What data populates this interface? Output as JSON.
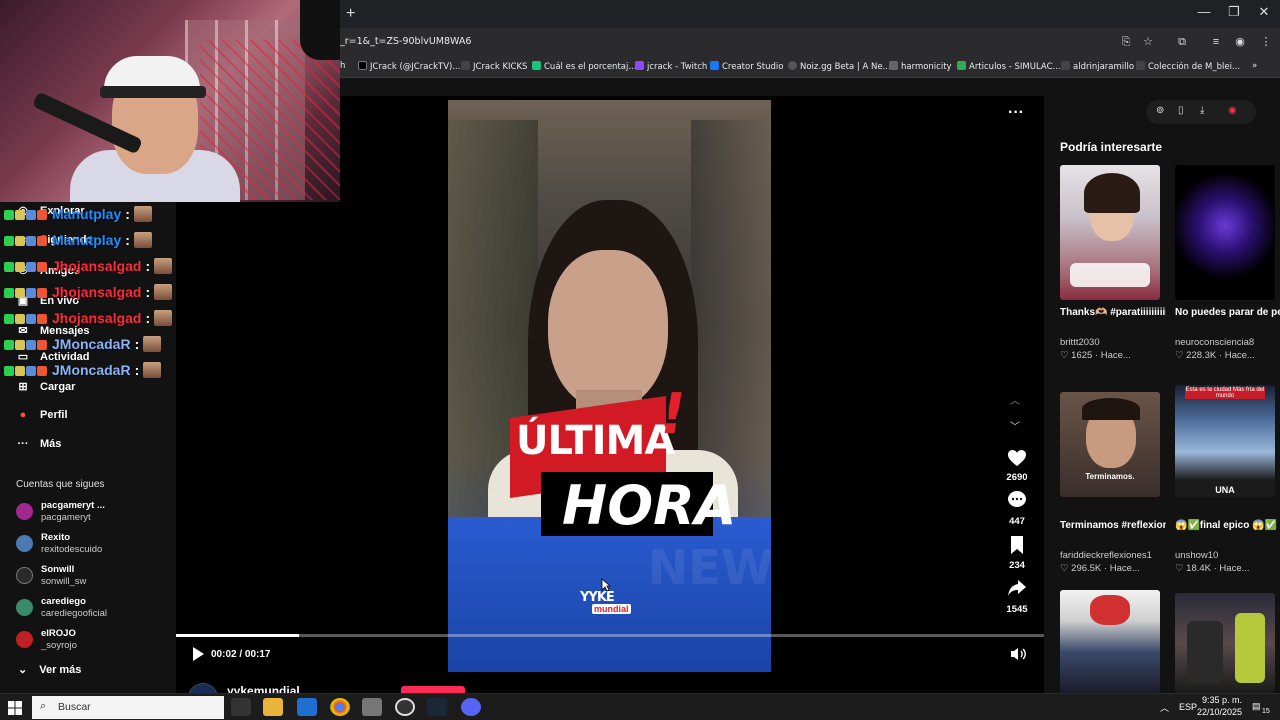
{
  "browser": {
    "url": "_r=1&_t=ZS-90blvUM8WA6",
    "new_tab": "+",
    "bookmarks": [
      {
        "label": "h",
        "color": "#1d1d1d"
      },
      {
        "label": "JCrack (@JCrackTV)...",
        "color": "#000000"
      },
      {
        "label": "JCrack KICKS",
        "color": "#333333"
      },
      {
        "label": "Cuál es el porcentaj...",
        "color": "#19c37d"
      },
      {
        "label": "jcrack - Twitch",
        "color": "#9146ff"
      },
      {
        "label": "Creator Studio",
        "color": "#1877f2"
      },
      {
        "label": "Noiz.gg Beta | A Ne...",
        "color": "#444444"
      },
      {
        "label": "harmonicity",
        "color": "#555555"
      },
      {
        "label": "Articulos - SIMULAC...",
        "color": "#34a853"
      },
      {
        "label": "aldrinjaramillo",
        "color": "#666666"
      },
      {
        "label": "Colección de M_blei...",
        "color": "#777777"
      }
    ]
  },
  "sidebar": {
    "items": [
      {
        "label": "Explorar",
        "icon": "compass-icon"
      },
      {
        "label": "Siguiendo",
        "icon": "following-icon"
      },
      {
        "label": "Amigos",
        "icon": "friends-icon"
      },
      {
        "label": "En vivo",
        "icon": "live-icon"
      },
      {
        "label": "Mensajes",
        "icon": "messages-icon"
      },
      {
        "label": "Actividad",
        "icon": "activity-icon"
      },
      {
        "label": "Cargar",
        "icon": "upload-icon"
      },
      {
        "label": "Perfil",
        "icon": "profile-icon"
      },
      {
        "label": "Más",
        "icon": "more-icon"
      }
    ],
    "following_title": "Cuentas que sigues",
    "accounts": [
      {
        "name": "pacgameryt ...",
        "handle": "pacgameryt",
        "color": "#a0288e"
      },
      {
        "name": "Rexito",
        "handle": "rexitodescuido",
        "color": "#4a7ab0"
      },
      {
        "name": "Sonwill",
        "handle": "sonwill_sw",
        "color": "#2a2a2a"
      },
      {
        "name": "carediego",
        "handle": "carediegooficial",
        "color": "#3a8a6a"
      },
      {
        "name": "elROJO",
        "handle": "_soyrojo",
        "color": "#c02020"
      }
    ],
    "see_more": "Ver más"
  },
  "chat": [
    {
      "user": "Manutplay",
      "color": "#1e90ff"
    },
    {
      "user": "Manutplay",
      "color": "#1e90ff"
    },
    {
      "user": "Jhojansalgad",
      "color": "#ff2a3a"
    },
    {
      "user": "Jhojansalgad",
      "color": "#ff2a3a"
    },
    {
      "user": "Jhojansalgad",
      "color": "#ff2a3a"
    },
    {
      "user": "JMoncadaR",
      "color": "#8ab4f8"
    },
    {
      "user": "JMoncadaR",
      "color": "#8ab4f8"
    }
  ],
  "chat_separator": ":",
  "video": {
    "headline_1": "ÚLTIMA",
    "headline_bang": "!",
    "headline_2": "HORA",
    "logo_top": "YYKE",
    "logo_bottom": "mundial",
    "watermark": "NEW",
    "time": "00:02 / 00:17",
    "progress": 0.1418
  },
  "actions": {
    "likes": "2690",
    "comments": "447",
    "saves": "234",
    "shares": "1545"
  },
  "author": {
    "name": "yykemundial"
  },
  "recommendations": {
    "heading": "Podría interesarte",
    "items": [
      {
        "title": "Thanks🫶🏼 #paratiiiiiiiiiiiiiiiiiii...",
        "user": "brittt2030",
        "stats": "1625 · Hace...",
        "thumb_text": ""
      },
      {
        "title": "No puedes parar de pensar en tu ex....",
        "user": "neuroconsciencia8",
        "stats": "228.3K · Hace...",
        "thumb_text": ""
      },
      {
        "title": "Terminamos #reflexionesdelavi...",
        "user": "fariddieckreflexiones1",
        "stats": "296.5K · Hace...",
        "thumb_text": "Terminamos."
      },
      {
        "title": "😱✅final epico 😱✅ esta es la ciuda...",
        "user": "unshow10",
        "stats": "18.4K · Hace...",
        "thumb_text": "UNA"
      },
      {
        "title": "",
        "user": "",
        "stats": "",
        "thumb_text": ""
      },
      {
        "title": "",
        "user": "",
        "stats": "",
        "thumb_text": ""
      }
    ],
    "thumb2_caption": "Esta es la ciudad Más fría del mundo"
  },
  "taskbar": {
    "search_label": "Buscar",
    "lang": "ESP",
    "time": "9:35 p. m.",
    "date": "22/10/2025",
    "notif": "15"
  }
}
